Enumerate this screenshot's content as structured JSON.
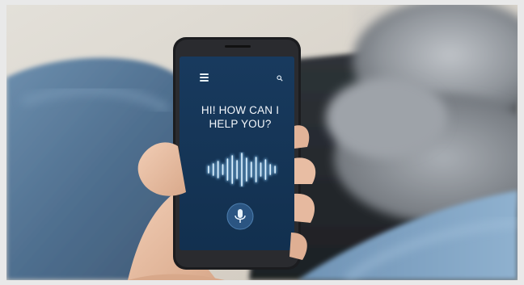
{
  "photo": {
    "subject": "hand holding smartphone with voice assistant app"
  },
  "assistant_screen": {
    "headline_line1": "HI! HOW CAN I",
    "headline_line2": "HELP YOU?",
    "menu_icon": "hamburger-menu-icon",
    "search_icon": "search-icon",
    "mic_icon": "microphone-icon",
    "wave_icon": "voice-waveform",
    "colors": {
      "screen_bg": "#153557",
      "text": "#f4f8fc",
      "wave": "#8fd0ff",
      "mic_circle": "#2b5582"
    }
  }
}
